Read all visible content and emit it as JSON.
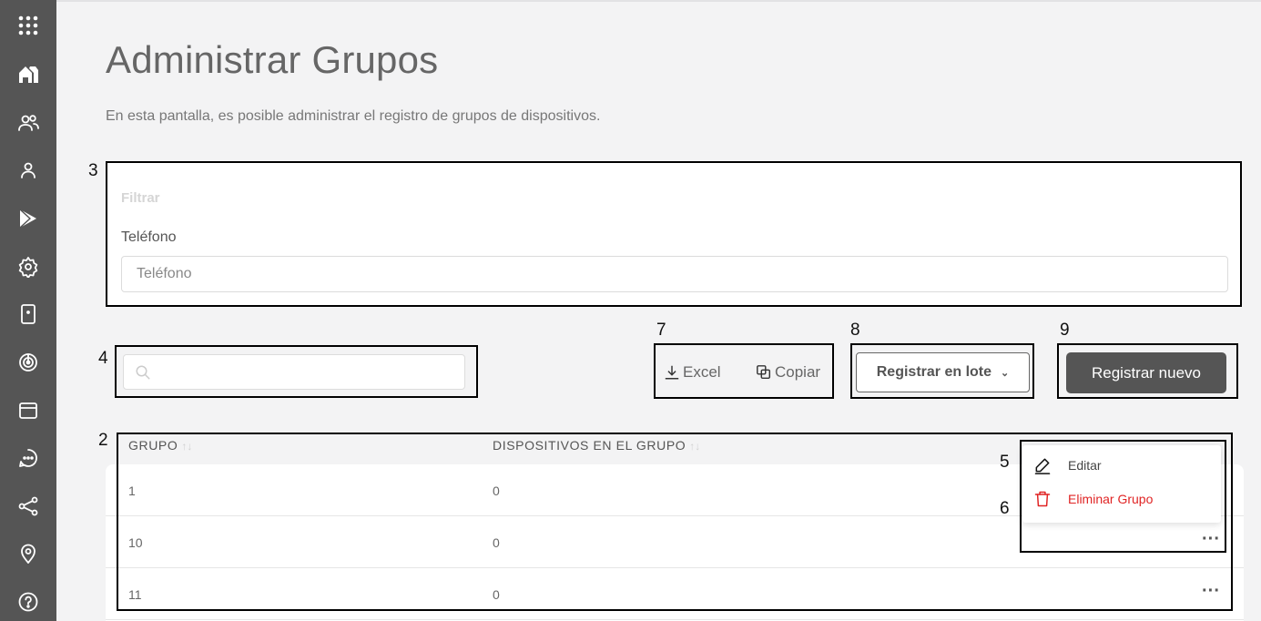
{
  "sidebar": {
    "icons": [
      "apps-grid-icon",
      "home-icon",
      "groups-icon",
      "user-icon",
      "play-store-icon",
      "settings-icon",
      "device-icon",
      "radar-icon",
      "window-icon",
      "chat-icon",
      "share-icon",
      "location-icon",
      "help-icon"
    ]
  },
  "page": {
    "title": "Administrar Grupos",
    "subtitle": "En esta pantalla, es posible administrar el registro de grupos de dispositivos."
  },
  "annotations": {
    "n2": "2",
    "n3": "3",
    "n4": "4",
    "n5": "5",
    "n6": "6",
    "n7": "7",
    "n8": "8",
    "n9": "9"
  },
  "filter": {
    "title": "Filtrar",
    "phone_label": "Teléfono",
    "phone_placeholder": "Teléfono",
    "phone_value": ""
  },
  "search": {
    "placeholder": "",
    "value": ""
  },
  "toolbar": {
    "excel_label": "Excel",
    "copy_label": "Copiar",
    "batch_label": "Registrar en lote",
    "new_label": "Registrar nuevo"
  },
  "table": {
    "columns": [
      "GRUPO",
      "DISPOSITIVOS EN EL GRUPO"
    ],
    "rows": [
      {
        "grupo": "1",
        "dispositivos": "0"
      },
      {
        "grupo": "10",
        "dispositivos": "0"
      },
      {
        "grupo": "11",
        "dispositivos": "0"
      }
    ]
  },
  "row_menu": {
    "edit_label": "Editar",
    "delete_label": "Eliminar Grupo"
  },
  "colors": {
    "sidebar": "#555555",
    "primary_button": "#555555",
    "danger": "#e02424",
    "background": "#f3f3f4"
  }
}
